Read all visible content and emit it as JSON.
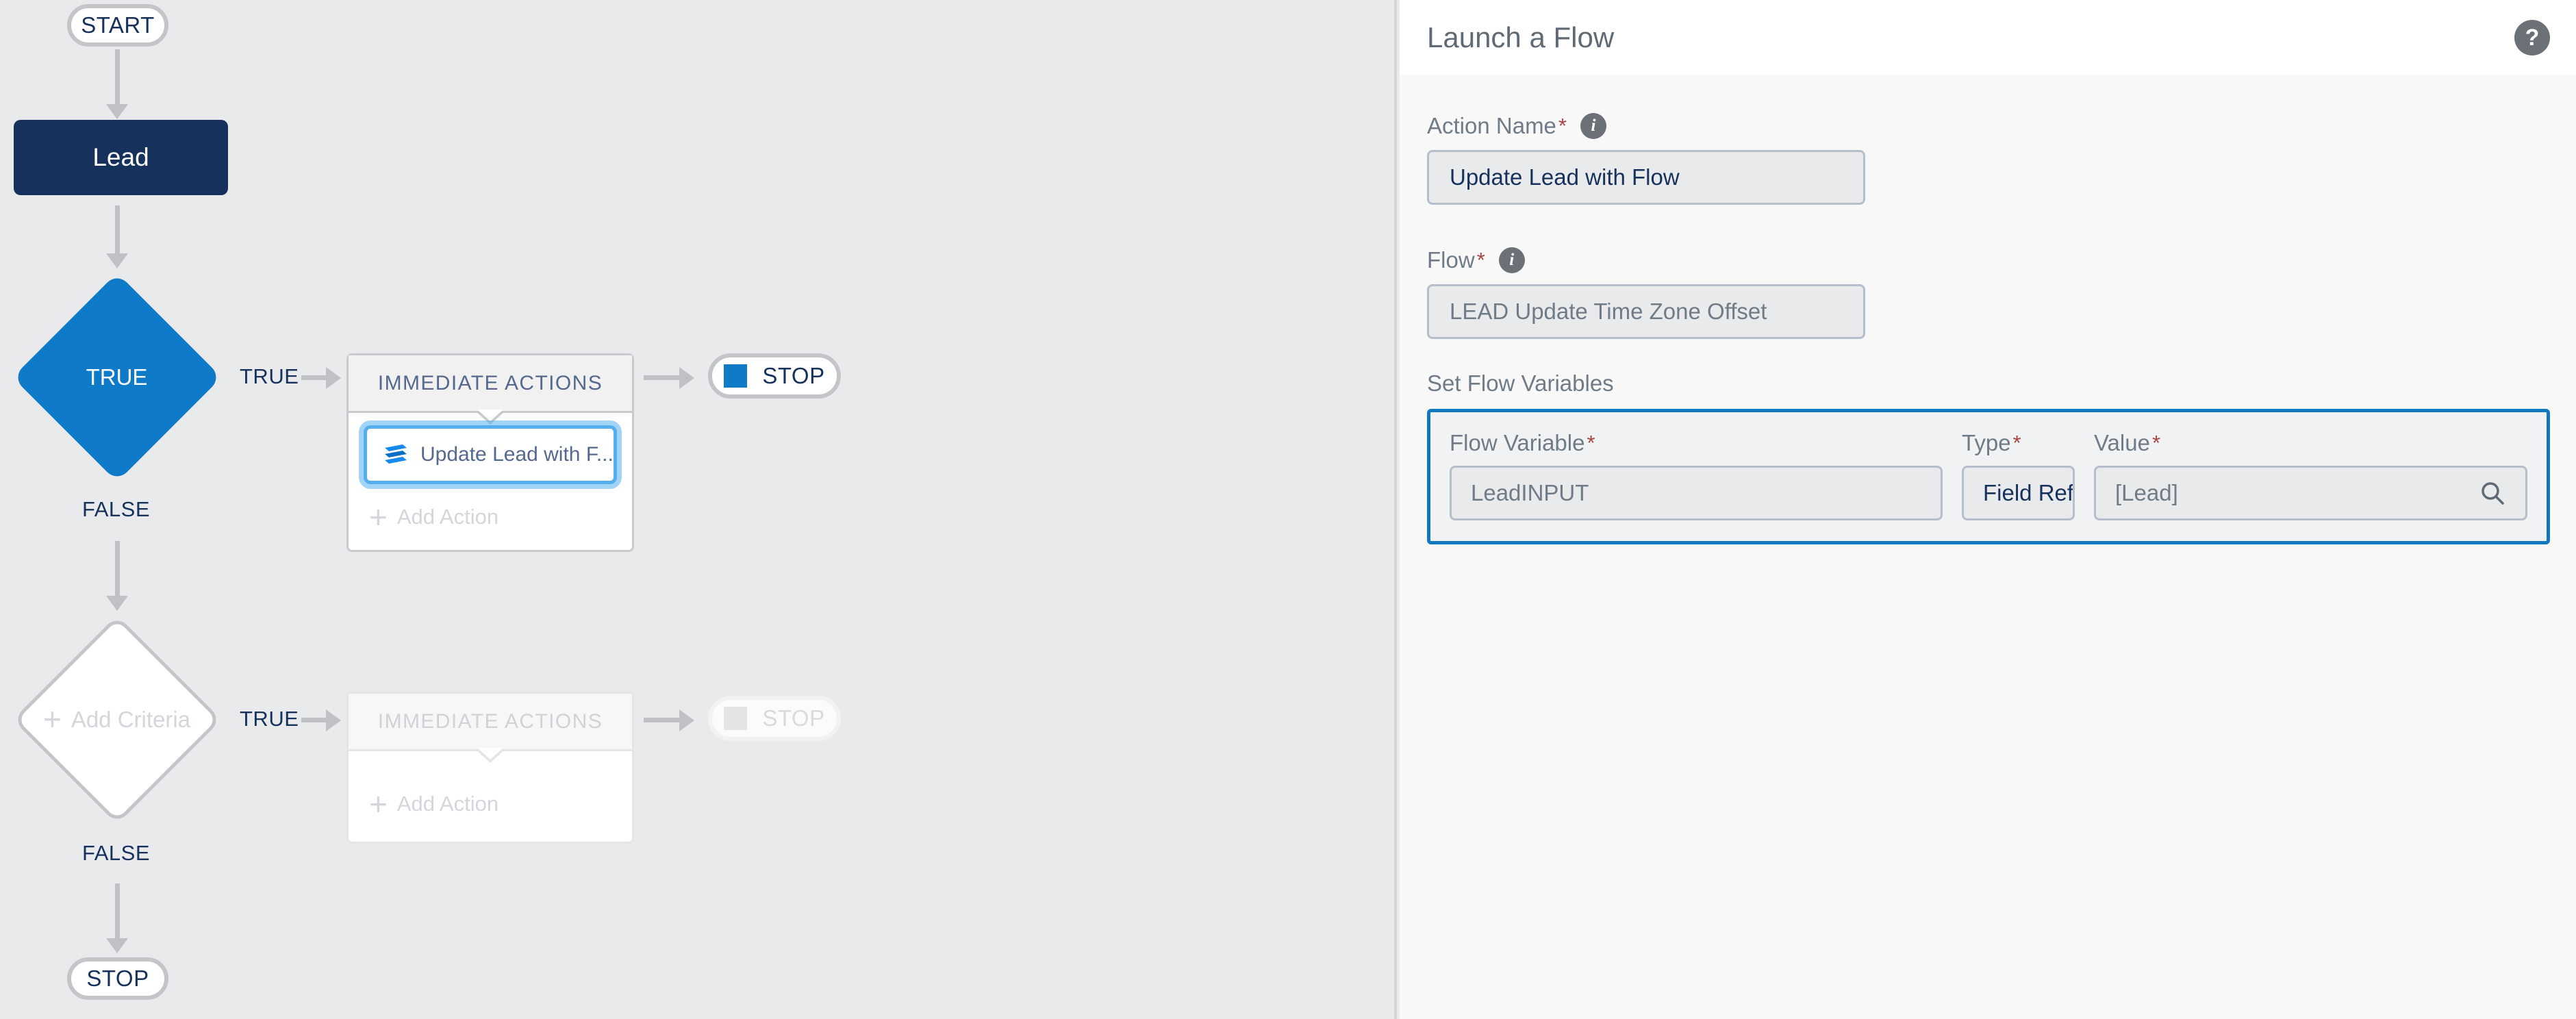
{
  "flowchart": {
    "start_label": "START",
    "object_node_label": "Lead",
    "criteria_1": {
      "label": "TRUE",
      "true_branch_label": "TRUE",
      "false_branch_label": "FALSE"
    },
    "criteria_2": {
      "label": "Add Criteria",
      "plus_glyph": "+",
      "true_branch_label": "TRUE",
      "false_branch_label": "FALSE"
    },
    "actions_panel_1": {
      "header": "IMMEDIATE ACTIONS",
      "action_label": "Update Lead with F...",
      "action_icon": "flow-icon",
      "add_action_label": "Add Action",
      "add_action_plus": "+"
    },
    "actions_panel_2": {
      "header": "IMMEDIATE ACTIONS",
      "add_action_label": "Add Action",
      "add_action_plus": "+"
    },
    "stop_1_label": "STOP",
    "stop_2_label": "STOP",
    "stop_3_label": "STOP",
    "colors": {
      "canvas_bg": "#e8eaec",
      "object_node": "#16325c",
      "criteria_active": "#0f7ac7",
      "connector": "#bfc1c4",
      "branch_text": "#16325c"
    }
  },
  "panel": {
    "title": "Launch a Flow",
    "help_icon": "?",
    "fields": {
      "action_name": {
        "label": "Action Name",
        "required_mark": "*",
        "info_icon": "i",
        "value": "Update Lead with Flow"
      },
      "flow": {
        "label": "Flow",
        "required_mark": "*",
        "info_icon": "i",
        "value": "LEAD Update Time Zone Offset"
      }
    },
    "set_flow_variables": {
      "section_label": "Set Flow Variables",
      "columns": {
        "flow_variable": {
          "label": "Flow Variable",
          "required_mark": "*",
          "value": "LeadINPUT"
        },
        "type": {
          "label": "Type",
          "required_mark": "*",
          "value": "Field Reference",
          "caret": "▾"
        },
        "value": {
          "label": "Value",
          "required_mark": "*",
          "value": "[Lead]",
          "search_icon": "search-icon"
        }
      },
      "highlight_color": "#1178c0"
    }
  }
}
